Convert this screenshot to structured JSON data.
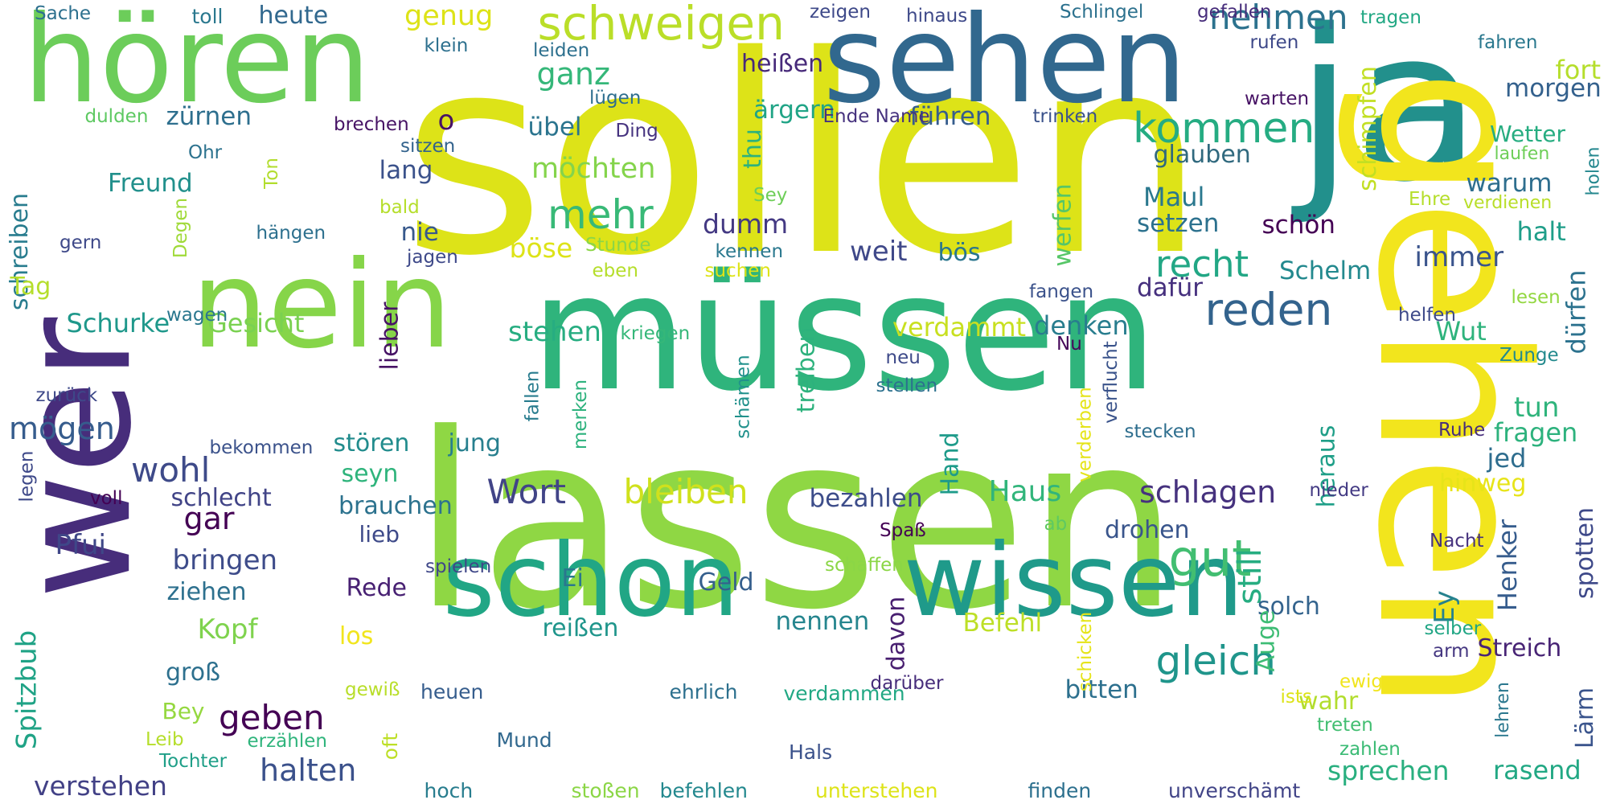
{
  "cloud": {
    "words": [
      {
        "text": "sollen",
        "color": "#dde318"
      },
      {
        "text": "lassen",
        "color": "#8fd744"
      },
      {
        "text": "müssen",
        "color": "#2fb47c"
      },
      {
        "text": "sehen",
        "color": "#31688e"
      },
      {
        "text": "ja",
        "color": "#22908c"
      },
      {
        "text": "hören",
        "color": "#6ccd5a"
      },
      {
        "text": "gehen",
        "color": "#f2e51d"
      },
      {
        "text": "wer",
        "color": "#472d7b"
      },
      {
        "text": "nein",
        "color": "#86d549"
      },
      {
        "text": "schon",
        "color": "#21a685"
      },
      {
        "text": "wissen",
        "color": "#1f9a8a"
      },
      {
        "text": "schweigen",
        "color": "#bade28"
      },
      {
        "text": "kommen",
        "color": "#25ac82"
      },
      {
        "text": "nehmen",
        "color": "#2c728e"
      },
      {
        "text": "reden",
        "color": "#33638d"
      },
      {
        "text": "gut",
        "color": "#42be71"
      },
      {
        "text": "recht",
        "color": "#22a785"
      },
      {
        "text": "gleich",
        "color": "#1f958b"
      },
      {
        "text": "mehr",
        "color": "#38b977"
      },
      {
        "text": "bleiben",
        "color": "#d0e11c"
      },
      {
        "text": "Wort",
        "color": "#414487"
      },
      {
        "text": "geben",
        "color": "#440154"
      },
      {
        "text": "halten",
        "color": "#3b518b"
      },
      {
        "text": "schlagen",
        "color": "#46327e"
      },
      {
        "text": "sprechen",
        "color": "#29af7f"
      },
      {
        "text": "wohl",
        "color": "#3e4a89"
      },
      {
        "text": "Haus",
        "color": "#31b57b"
      },
      {
        "text": "Geld",
        "color": "#355f8d"
      },
      {
        "text": "still",
        "color": "#26ad81"
      },
      {
        "text": "glauben",
        "color": "#30697e"
      },
      {
        "text": "immer",
        "color": "#3a548c"
      },
      {
        "text": "ganz",
        "color": "#35b779"
      },
      {
        "text": "möchten",
        "color": "#84d44b"
      },
      {
        "text": "verdammt",
        "color": "#c8e020"
      },
      {
        "text": "stehen",
        "color": "#27ad81"
      },
      {
        "text": "denken",
        "color": "#287d8e"
      },
      {
        "text": "bezahlen",
        "color": "#3d4d8a"
      },
      {
        "text": "Befehl",
        "color": "#bddf26"
      },
      {
        "text": "nennen",
        "color": "#25858e"
      },
      {
        "text": "bitten",
        "color": "#2d708e"
      },
      {
        "text": "mögen",
        "color": "#365c8d"
      },
      {
        "text": "Schurke",
        "color": "#1f988b"
      },
      {
        "text": "Gesicht",
        "color": "#7ad151"
      },
      {
        "text": "Kopf",
        "color": "#7fd34e"
      },
      {
        "text": "Pfui",
        "color": "#3f4788"
      },
      {
        "text": "bringen",
        "color": "#3e4c8a"
      },
      {
        "text": "verstehen",
        "color": "#424186"
      },
      {
        "text": "Spitzbub",
        "color": "#20a386"
      },
      {
        "text": "Maul",
        "color": "#2a788e"
      },
      {
        "text": "warum",
        "color": "#2e6e8e"
      },
      {
        "text": "fort",
        "color": "#b5de2b"
      },
      {
        "text": "morgen",
        "color": "#34618d"
      },
      {
        "text": "übel",
        "color": "#2b748e"
      },
      {
        "text": "ärgern",
        "color": "#20a486"
      },
      {
        "text": "heißen",
        "color": "#472a7a"
      },
      {
        "text": "führen",
        "color": "#365d8d"
      },
      {
        "text": "zürnen",
        "color": "#2e6f8e"
      },
      {
        "text": "lang",
        "color": "#3b528b"
      },
      {
        "text": "Freund",
        "color": "#22908c"
      },
      {
        "text": "schreiben",
        "color": "#287c8e"
      },
      {
        "text": "nie",
        "color": "#38598c"
      },
      {
        "text": "böse",
        "color": "#dde318"
      },
      {
        "text": "dumm",
        "color": "#443983"
      },
      {
        "text": "weit",
        "color": "#3f4889"
      },
      {
        "text": "bös",
        "color": "#2a768e"
      },
      {
        "text": "werfen",
        "color": "#56c667"
      },
      {
        "text": "schön",
        "color": "#440154"
      },
      {
        "text": "setzen",
        "color": "#2c718e"
      },
      {
        "text": "dafür",
        "color": "#46307e"
      },
      {
        "text": "Schelm",
        "color": "#23898e"
      },
      {
        "text": "halt",
        "color": "#1f9e89"
      },
      {
        "text": "Wut",
        "color": "#2eb37c"
      },
      {
        "text": "dürfen",
        "color": "#2c728e"
      },
      {
        "text": "tun",
        "color": "#2fb47c"
      },
      {
        "text": "fragen",
        "color": "#2db27d"
      },
      {
        "text": "jed",
        "color": "#2e6d8e"
      },
      {
        "text": "hinweg",
        "color": "#e7e419"
      },
      {
        "text": "heraus",
        "color": "#1f9f88"
      },
      {
        "text": "Henker",
        "color": "#365c8d"
      },
      {
        "text": "Ey",
        "color": "#26828e"
      },
      {
        "text": "solch",
        "color": "#33638d"
      },
      {
        "text": "Streich",
        "color": "#482475"
      },
      {
        "text": "spotten",
        "color": "#3e4989"
      },
      {
        "text": "rasend",
        "color": "#22a884"
      },
      {
        "text": "Lärm",
        "color": "#3a548c"
      },
      {
        "text": "wahr",
        "color": "#b2dd2d"
      },
      {
        "text": "drohen",
        "color": "#39558c"
      },
      {
        "text": "Auge",
        "color": "#3dbc74"
      },
      {
        "text": "davon",
        "color": "#481f70"
      },
      {
        "text": "reißen",
        "color": "#1f958b"
      },
      {
        "text": "Ei",
        "color": "#2a778e"
      },
      {
        "text": "Rede",
        "color": "#482173"
      },
      {
        "text": "los",
        "color": "#f1e51d"
      },
      {
        "text": "ziehen",
        "color": "#2d708e"
      },
      {
        "text": "groß",
        "color": "#2d708e"
      },
      {
        "text": "Bey",
        "color": "#95d840"
      },
      {
        "text": "gar",
        "color": "#440154"
      },
      {
        "text": "schlecht",
        "color": "#414487"
      },
      {
        "text": "seyn",
        "color": "#2fb47c"
      },
      {
        "text": "brauchen",
        "color": "#2c728e"
      },
      {
        "text": "lieb",
        "color": "#3e4a89"
      },
      {
        "text": "stören",
        "color": "#228c8d"
      },
      {
        "text": "jung",
        "color": "#277f8e"
      },
      {
        "text": "Hand",
        "color": "#1e9b8a"
      },
      {
        "text": "lieber",
        "color": "#471365"
      },
      {
        "text": "treiben",
        "color": "#2db27d"
      },
      {
        "text": "Tag",
        "color": "#b5de2b"
      },
      {
        "text": "thu",
        "color": "#2db27d"
      },
      {
        "text": "schimpfen",
        "color": "#c2df23"
      },
      {
        "text": "verdienen",
        "color": "#b8de29"
      },
      {
        "text": "laufen",
        "color": "#6ece58"
      },
      {
        "text": "holen",
        "color": "#24878e"
      },
      {
        "text": "Wetter",
        "color": "#27ad81"
      },
      {
        "text": "Ehre",
        "color": "#b5de2b"
      },
      {
        "text": "lesen",
        "color": "#93d741"
      },
      {
        "text": "helfen",
        "color": "#3e4a89"
      },
      {
        "text": "Zunge",
        "color": "#238a8d"
      },
      {
        "text": "Ruhe",
        "color": "#472d7b"
      },
      {
        "text": "Nacht",
        "color": "#46327e"
      },
      {
        "text": "selber",
        "color": "#21a685"
      },
      {
        "text": "arm",
        "color": "#453781"
      },
      {
        "text": "lehren",
        "color": "#2a778e"
      },
      {
        "text": "zahlen",
        "color": "#3bbb75"
      },
      {
        "text": "treten",
        "color": "#42be71"
      },
      {
        "text": "ists",
        "color": "#dde318"
      },
      {
        "text": "ewig",
        "color": "#f1e51d"
      },
      {
        "text": "unverschämt",
        "color": "#414487"
      },
      {
        "text": "finden",
        "color": "#2d708e"
      },
      {
        "text": "unterstehen",
        "color": "#dde318"
      },
      {
        "text": "befehlen",
        "color": "#23888e"
      },
      {
        "text": "stoßen",
        "color": "#8bd646"
      },
      {
        "text": "hoch",
        "color": "#287d8e"
      },
      {
        "text": "Hals",
        "color": "#3b528b"
      },
      {
        "text": "Mund",
        "color": "#31688e"
      },
      {
        "text": "verdammen",
        "color": "#22a884"
      },
      {
        "text": "darüber",
        "color": "#472d7b"
      },
      {
        "text": "ehrlich",
        "color": "#2d708e"
      },
      {
        "text": "heuen",
        "color": "#365d8d"
      },
      {
        "text": "gewiß",
        "color": "#b8de29"
      },
      {
        "text": "erzählen",
        "color": "#2fb47c"
      },
      {
        "text": "oft",
        "color": "#bddf26"
      },
      {
        "text": "Leib",
        "color": "#b5de2b"
      },
      {
        "text": "Tochter",
        "color": "#1f9f88"
      },
      {
        "text": "schicken",
        "color": "#e5e419"
      },
      {
        "text": "schaffen",
        "color": "#8bd646"
      },
      {
        "text": "spielen",
        "color": "#3f4788"
      },
      {
        "text": "Spaß",
        "color": "#440154"
      },
      {
        "text": "ab",
        "color": "#5ec962"
      },
      {
        "text": "merken",
        "color": "#2db27d"
      },
      {
        "text": "fallen",
        "color": "#287c8e"
      },
      {
        "text": "schämen",
        "color": "#21918c"
      },
      {
        "text": "stellen",
        "color": "#2c718e"
      },
      {
        "text": "neu",
        "color": "#3e4a89"
      },
      {
        "text": "Nu",
        "color": "#46075a"
      },
      {
        "text": "verflucht",
        "color": "#3a538b"
      },
      {
        "text": "verderben",
        "color": "#e5e419"
      },
      {
        "text": "stecken",
        "color": "#2e6e8e"
      },
      {
        "text": "nieder",
        "color": "#443b84"
      },
      {
        "text": "voll",
        "color": "#440154"
      },
      {
        "text": "legen",
        "color": "#3e4989"
      },
      {
        "text": "bekommen",
        "color": "#3b528b"
      },
      {
        "text": "zurück",
        "color": "#3e4989"
      },
      {
        "text": "wagen",
        "color": "#2a778e"
      },
      {
        "text": "gern",
        "color": "#3e4989"
      },
      {
        "text": "hängen",
        "color": "#2d708e"
      },
      {
        "text": "jagen",
        "color": "#3e4989"
      },
      {
        "text": "Degen",
        "color": "#a0da39"
      },
      {
        "text": "Ton",
        "color": "#b2dd2d"
      },
      {
        "text": "bald",
        "color": "#b5de2b"
      },
      {
        "text": "Stunde",
        "color": "#8bd646"
      },
      {
        "text": "eben",
        "color": "#b5de2b"
      },
      {
        "text": "kennen",
        "color": "#2a788e"
      },
      {
        "text": "suchen",
        "color": "#dde318"
      },
      {
        "text": "fangen",
        "color": "#3b528b"
      },
      {
        "text": "kriegen",
        "color": "#35b779"
      },
      {
        "text": "Sey",
        "color": "#6ece58"
      },
      {
        "text": "Ohr",
        "color": "#2c728e"
      },
      {
        "text": "sitzen",
        "color": "#33638d"
      },
      {
        "text": "brechen",
        "color": "#471365"
      },
      {
        "text": "Ding",
        "color": "#46337f"
      },
      {
        "text": "lügen",
        "color": "#2e6e8e"
      },
      {
        "text": "leiden",
        "color": "#2d708e"
      },
      {
        "text": "klein",
        "color": "#2d708e"
      },
      {
        "text": "dulden",
        "color": "#5ec962"
      },
      {
        "text": "o",
        "color": "#471365"
      },
      {
        "text": "Ende Name",
        "color": "#46327e"
      },
      {
        "text": "trinken",
        "color": "#3b528b"
      },
      {
        "text": "warten",
        "color": "#471365"
      },
      {
        "text": "rufen",
        "color": "#3e4989"
      },
      {
        "text": "fahren",
        "color": "#2a788e"
      },
      {
        "text": "tragen",
        "color": "#22a884"
      },
      {
        "text": "Schlingel",
        "color": "#2c718e"
      },
      {
        "text": "gefallen",
        "color": "#472d7b"
      },
      {
        "text": "hinaus",
        "color": "#3e4989"
      },
      {
        "text": "zeigen",
        "color": "#3e4989"
      },
      {
        "text": "toll",
        "color": "#2a788e"
      },
      {
        "text": "heute",
        "color": "#31688e"
      },
      {
        "text": "genug",
        "color": "#dde318"
      },
      {
        "text": "Sache",
        "color": "#2d708e"
      }
    ]
  }
}
